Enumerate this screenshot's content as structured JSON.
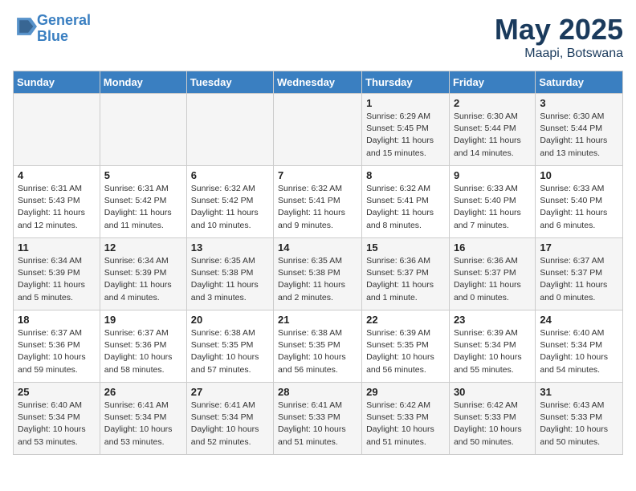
{
  "header": {
    "logo_line1": "General",
    "logo_line2": "Blue",
    "month": "May 2025",
    "location": "Maapi, Botswana"
  },
  "weekdays": [
    "Sunday",
    "Monday",
    "Tuesday",
    "Wednesday",
    "Thursday",
    "Friday",
    "Saturday"
  ],
  "weeks": [
    [
      {
        "day": "",
        "info": ""
      },
      {
        "day": "",
        "info": ""
      },
      {
        "day": "",
        "info": ""
      },
      {
        "day": "",
        "info": ""
      },
      {
        "day": "1",
        "info": "Sunrise: 6:29 AM\nSunset: 5:45 PM\nDaylight: 11 hours and 15 minutes."
      },
      {
        "day": "2",
        "info": "Sunrise: 6:30 AM\nSunset: 5:44 PM\nDaylight: 11 hours and 14 minutes."
      },
      {
        "day": "3",
        "info": "Sunrise: 6:30 AM\nSunset: 5:44 PM\nDaylight: 11 hours and 13 minutes."
      }
    ],
    [
      {
        "day": "4",
        "info": "Sunrise: 6:31 AM\nSunset: 5:43 PM\nDaylight: 11 hours and 12 minutes."
      },
      {
        "day": "5",
        "info": "Sunrise: 6:31 AM\nSunset: 5:42 PM\nDaylight: 11 hours and 11 minutes."
      },
      {
        "day": "6",
        "info": "Sunrise: 6:32 AM\nSunset: 5:42 PM\nDaylight: 11 hours and 10 minutes."
      },
      {
        "day": "7",
        "info": "Sunrise: 6:32 AM\nSunset: 5:41 PM\nDaylight: 11 hours and 9 minutes."
      },
      {
        "day": "8",
        "info": "Sunrise: 6:32 AM\nSunset: 5:41 PM\nDaylight: 11 hours and 8 minutes."
      },
      {
        "day": "9",
        "info": "Sunrise: 6:33 AM\nSunset: 5:40 PM\nDaylight: 11 hours and 7 minutes."
      },
      {
        "day": "10",
        "info": "Sunrise: 6:33 AM\nSunset: 5:40 PM\nDaylight: 11 hours and 6 minutes."
      }
    ],
    [
      {
        "day": "11",
        "info": "Sunrise: 6:34 AM\nSunset: 5:39 PM\nDaylight: 11 hours and 5 minutes."
      },
      {
        "day": "12",
        "info": "Sunrise: 6:34 AM\nSunset: 5:39 PM\nDaylight: 11 hours and 4 minutes."
      },
      {
        "day": "13",
        "info": "Sunrise: 6:35 AM\nSunset: 5:38 PM\nDaylight: 11 hours and 3 minutes."
      },
      {
        "day": "14",
        "info": "Sunrise: 6:35 AM\nSunset: 5:38 PM\nDaylight: 11 hours and 2 minutes."
      },
      {
        "day": "15",
        "info": "Sunrise: 6:36 AM\nSunset: 5:37 PM\nDaylight: 11 hours and 1 minute."
      },
      {
        "day": "16",
        "info": "Sunrise: 6:36 AM\nSunset: 5:37 PM\nDaylight: 11 hours and 0 minutes."
      },
      {
        "day": "17",
        "info": "Sunrise: 6:37 AM\nSunset: 5:37 PM\nDaylight: 11 hours and 0 minutes."
      }
    ],
    [
      {
        "day": "18",
        "info": "Sunrise: 6:37 AM\nSunset: 5:36 PM\nDaylight: 10 hours and 59 minutes."
      },
      {
        "day": "19",
        "info": "Sunrise: 6:37 AM\nSunset: 5:36 PM\nDaylight: 10 hours and 58 minutes."
      },
      {
        "day": "20",
        "info": "Sunrise: 6:38 AM\nSunset: 5:35 PM\nDaylight: 10 hours and 57 minutes."
      },
      {
        "day": "21",
        "info": "Sunrise: 6:38 AM\nSunset: 5:35 PM\nDaylight: 10 hours and 56 minutes."
      },
      {
        "day": "22",
        "info": "Sunrise: 6:39 AM\nSunset: 5:35 PM\nDaylight: 10 hours and 56 minutes."
      },
      {
        "day": "23",
        "info": "Sunrise: 6:39 AM\nSunset: 5:34 PM\nDaylight: 10 hours and 55 minutes."
      },
      {
        "day": "24",
        "info": "Sunrise: 6:40 AM\nSunset: 5:34 PM\nDaylight: 10 hours and 54 minutes."
      }
    ],
    [
      {
        "day": "25",
        "info": "Sunrise: 6:40 AM\nSunset: 5:34 PM\nDaylight: 10 hours and 53 minutes."
      },
      {
        "day": "26",
        "info": "Sunrise: 6:41 AM\nSunset: 5:34 PM\nDaylight: 10 hours and 53 minutes."
      },
      {
        "day": "27",
        "info": "Sunrise: 6:41 AM\nSunset: 5:34 PM\nDaylight: 10 hours and 52 minutes."
      },
      {
        "day": "28",
        "info": "Sunrise: 6:41 AM\nSunset: 5:33 PM\nDaylight: 10 hours and 51 minutes."
      },
      {
        "day": "29",
        "info": "Sunrise: 6:42 AM\nSunset: 5:33 PM\nDaylight: 10 hours and 51 minutes."
      },
      {
        "day": "30",
        "info": "Sunrise: 6:42 AM\nSunset: 5:33 PM\nDaylight: 10 hours and 50 minutes."
      },
      {
        "day": "31",
        "info": "Sunrise: 6:43 AM\nSunset: 5:33 PM\nDaylight: 10 hours and 50 minutes."
      }
    ]
  ]
}
